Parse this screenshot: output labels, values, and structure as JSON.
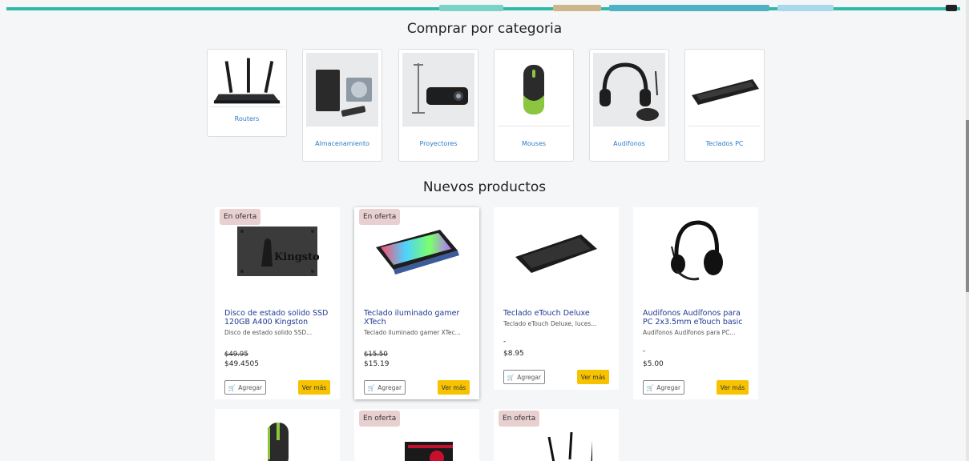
{
  "sections": {
    "categories_title": "Comprar por categoria",
    "products_title": "Nuevos productos"
  },
  "categories": [
    {
      "label": "Routers",
      "icon": "router-icon"
    },
    {
      "label": "Almacenamiento",
      "icon": "storage-icon"
    },
    {
      "label": "Proyectores",
      "icon": "projector-icon"
    },
    {
      "label": "Mouses",
      "icon": "mouse-icon"
    },
    {
      "label": "Audifonos",
      "icon": "headphones-icon"
    },
    {
      "label": "Teclados PC",
      "icon": "keyboard-icon"
    }
  ],
  "products": [
    {
      "badge": "En oferta",
      "title": "Disco de estado solido SSD 120GB A400 Kingston",
      "desc": "Disco de estado solido SSD...",
      "old_price": "$49.95",
      "price": "$49.4505",
      "add": "Agregar",
      "more": "Ver más",
      "image_text": "Kingston"
    },
    {
      "badge": "En oferta",
      "title": "Teclado iluminado gamer XTech",
      "desc": "Teclado iluminado gamer XTec...",
      "old_price": "$15.50",
      "price": "$15.19",
      "add": "Agregar",
      "more": "Ver más"
    },
    {
      "title": "Teclado eTouch Deluxe",
      "desc": "Teclado eTouch Deluxe, luces...",
      "old_price": "-",
      "price": "$8.95",
      "add": "Agregar",
      "more": "Ver más"
    },
    {
      "title": "Audifonos Audífonos para PC 2x3.5mm eTouch basic",
      "desc": "Audífonos Audífonos para PC...",
      "old_price": "-",
      "price": "$5.00",
      "add": "Agregar",
      "more": "Ver más"
    }
  ],
  "bottom_row": [
    {
      "badge": ""
    },
    {
      "badge": "En oferta"
    },
    {
      "badge": "En oferta"
    }
  ],
  "colors": {
    "accent": "#2fb9a9",
    "link": "#2d7bc5",
    "title": "#1f3a93",
    "button_yellow": "#f7c300",
    "badge": "#e8cfd0"
  }
}
